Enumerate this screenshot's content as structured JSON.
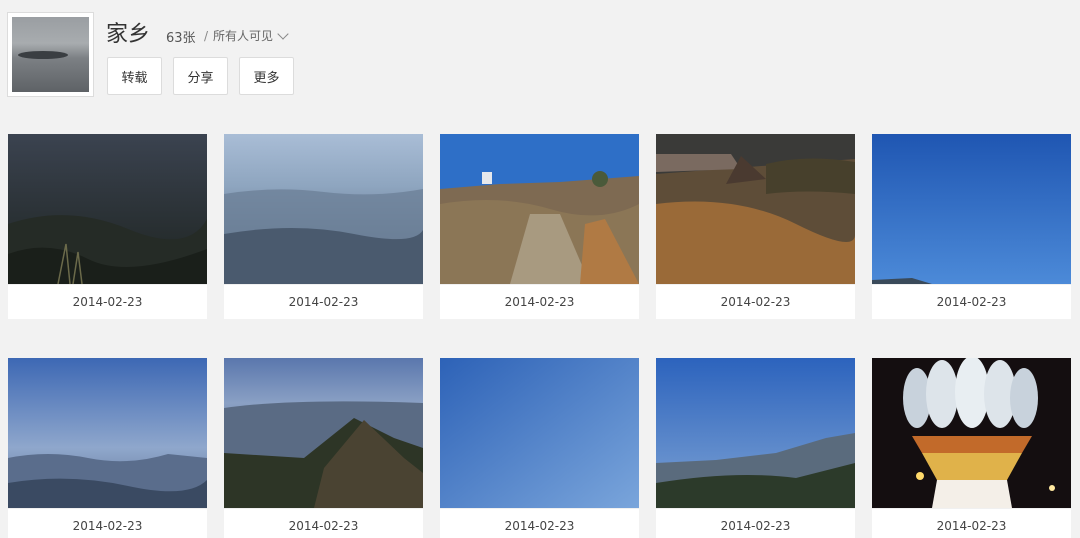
{
  "album": {
    "title": "家乡",
    "count": "63张",
    "separator": "/",
    "visibility": "所有人可见",
    "dropdown_icon": "chevron-down-icon"
  },
  "actions": {
    "repost_label": "转载",
    "share_label": "分享",
    "more_label": "更多"
  },
  "photos": [
    {
      "date": "2014-02-23",
      "scene": "dark-hillside"
    },
    {
      "date": "2014-02-23",
      "scene": "hazy-valley"
    },
    {
      "date": "2014-02-23",
      "scene": "stone-steps"
    },
    {
      "date": "2014-02-23",
      "scene": "hut-hillside"
    },
    {
      "date": "2014-02-23",
      "scene": "blue-sky"
    },
    {
      "date": "2014-02-23",
      "scene": "blue-mountains"
    },
    {
      "date": "2014-02-23",
      "scene": "mountain-peak"
    },
    {
      "date": "2014-02-23",
      "scene": "clear-sky"
    },
    {
      "date": "2014-02-23",
      "scene": "ridge-sky"
    },
    {
      "date": "2014-02-23",
      "scene": "lotus-lamp-night"
    }
  ]
}
